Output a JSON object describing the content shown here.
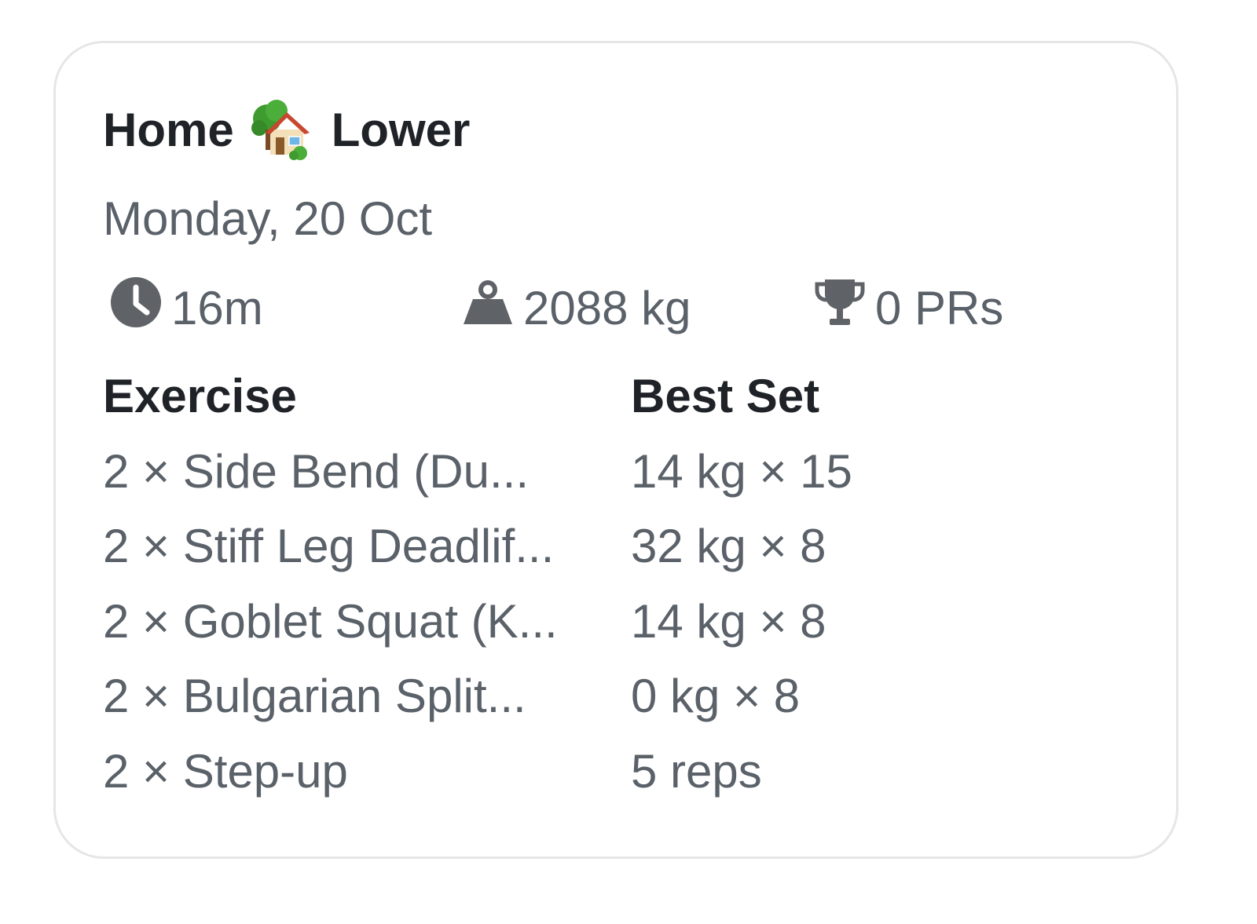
{
  "workout": {
    "title_before": "Home",
    "title_after": "Lower",
    "title_icon": "house-with-garden-icon",
    "date": "Monday, 20 Oct"
  },
  "stats": {
    "duration": "16m",
    "volume": "2088 kg",
    "prs": "0 PRs",
    "duration_icon": "clock-icon",
    "volume_icon": "weight-icon",
    "prs_icon": "trophy-icon"
  },
  "table": {
    "headers": [
      "Exercise",
      "Best Set"
    ],
    "rows": [
      {
        "exercise": "2 × Side Bend (Du...",
        "best_set": "14 kg × 15"
      },
      {
        "exercise": "2 × Stiff Leg Deadlif...",
        "best_set": "32 kg × 8"
      },
      {
        "exercise": "2 × Goblet Squat (K...",
        "best_set": "14 kg × 8"
      },
      {
        "exercise": "2 × Bulgarian Split...",
        "best_set": "0 kg × 8"
      },
      {
        "exercise": "2 × Step-up",
        "best_set": "5 reps"
      }
    ]
  },
  "colors": {
    "title_text": "#1f2328",
    "secondary_text": "#5a6169",
    "card_border": "#e6e6e6",
    "icon_gray": "#5f6368"
  }
}
